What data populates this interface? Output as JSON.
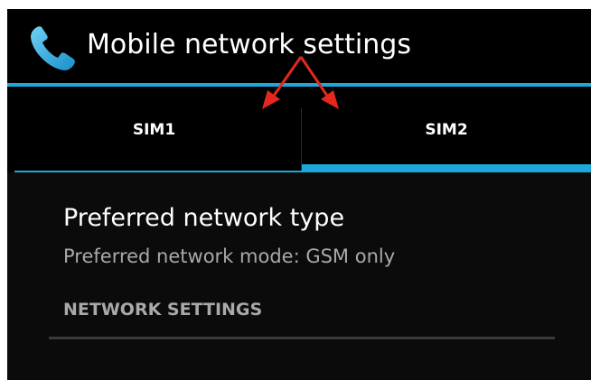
{
  "app": {
    "title": "Mobile network settings",
    "icon": "phone-icon",
    "accent_color": "#1ea7d9"
  },
  "tabs": [
    {
      "label": "SIM1",
      "selected": false
    },
    {
      "label": "SIM2",
      "selected": true
    }
  ],
  "preference": {
    "title": "Preferred network type",
    "summary": "Preferred network mode: GSM only"
  },
  "section": {
    "header": "NETWORK SETTINGS"
  },
  "annotation": {
    "arrow_color": "#e5281d",
    "arrow_icon": "red-arrow-icon"
  }
}
